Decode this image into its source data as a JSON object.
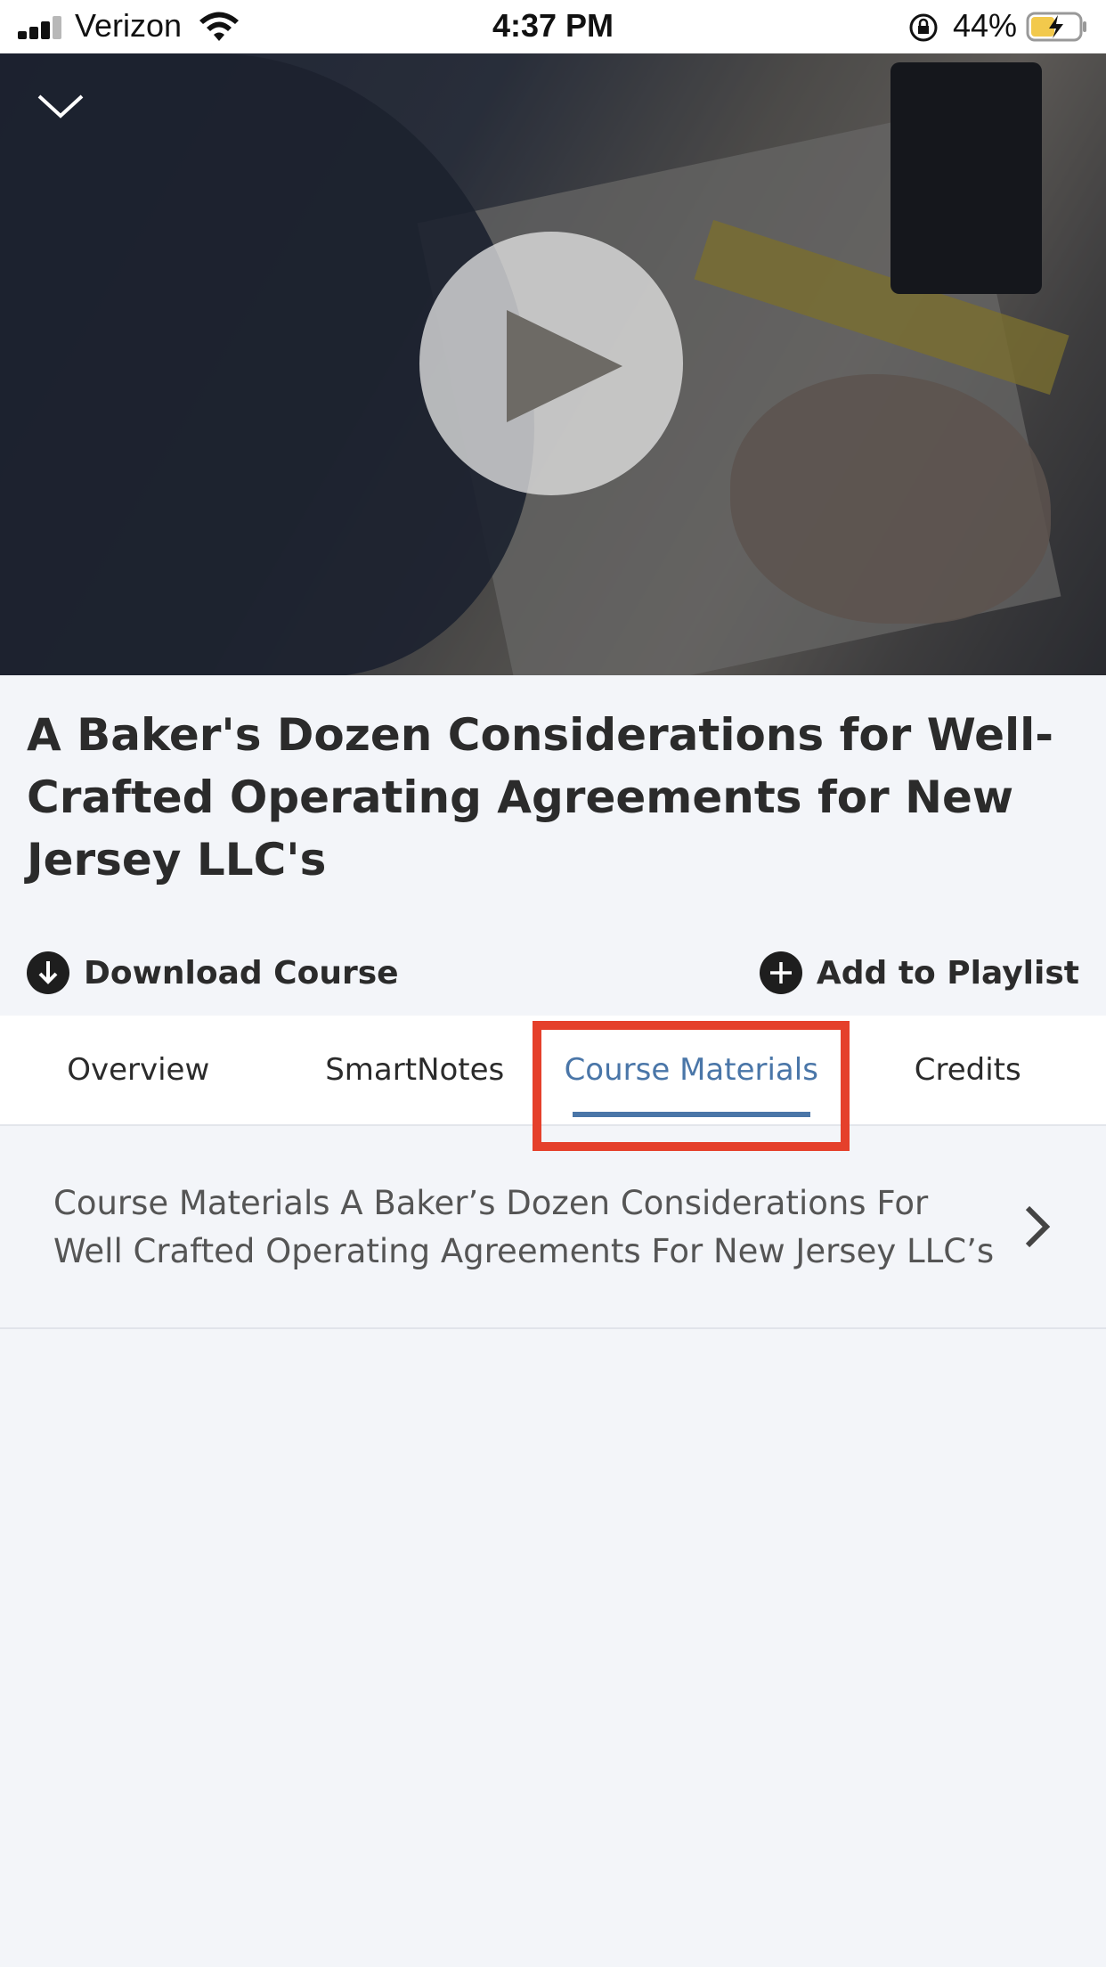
{
  "status_bar": {
    "carrier": "Verizon",
    "time": "4:37 PM",
    "battery_percent": "44%",
    "icons": [
      "signal-icon",
      "wifi-icon",
      "rotation-lock-icon",
      "battery-charging-icon"
    ]
  },
  "video": {
    "collapse_icon": "chevron-down-icon",
    "play_icon": "play-icon"
  },
  "course": {
    "title": "A Baker's Dozen Considerations for Well-Crafted Operating Agreements for New Jersey LLC's"
  },
  "actions": {
    "download_label": "Download Course",
    "playlist_label": "Add to Playlist"
  },
  "tabs": [
    {
      "label": "Overview",
      "active": false
    },
    {
      "label": "SmartNotes",
      "active": false
    },
    {
      "label": "Course Materials",
      "active": true
    },
    {
      "label": "Credits",
      "active": false
    }
  ],
  "materials": [
    {
      "label": "Course Materials A Baker’s Dozen Considerations For Well Crafted Operating Agreements For New Jersey LLC’s"
    }
  ],
  "colors": {
    "accent": "#4a76a8",
    "highlight": "#e5402b",
    "background": "#f3f5f9"
  }
}
